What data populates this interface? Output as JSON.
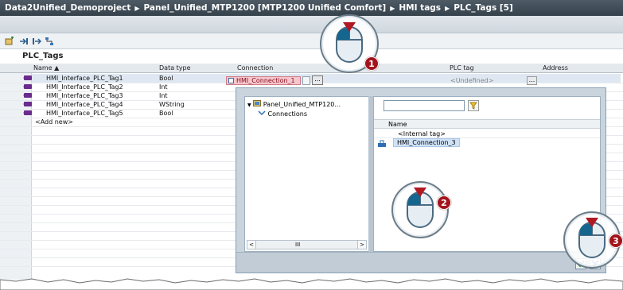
{
  "breadcrumb": {
    "items": [
      "Data2Unified_Demoproject",
      "Panel_Unified_MTP1200 [MTP1200 Unified Comfort]",
      "HMI tags",
      "PLC_Tags [5]"
    ],
    "separator": "▶"
  },
  "table": {
    "title": "PLC_Tags",
    "columns": [
      "Name ▲",
      "Data type",
      "Connection",
      "PLC tag",
      "Address"
    ],
    "rows": [
      {
        "name": "HMI_Interface_PLC_Tag1",
        "type": "Bool",
        "connection": "HMI_Connection_1",
        "plc_tag": "<Undefined>"
      },
      {
        "name": "HMI_Interface_PLC_Tag2",
        "type": "Int"
      },
      {
        "name": "HMI_Interface_PLC_Tag3",
        "type": "Int"
      },
      {
        "name": "HMI_Interface_PLC_Tag4",
        "type": "WString"
      },
      {
        "name": "HMI_Interface_PLC_Tag5",
        "type": "Bool"
      }
    ],
    "add_new": "<Add new>",
    "dots": "..."
  },
  "popup": {
    "tree": {
      "root": "Panel_Unified_MTP120...",
      "child": "Connections"
    },
    "filter_value": "",
    "name_header": "Name",
    "items": [
      "<Internal tag>",
      "HMI_Connection_3"
    ],
    "scroll_mid": "III"
  },
  "callouts": [
    "1",
    "2",
    "3"
  ],
  "colors": {
    "title_bg": "#3e4a55",
    "highlight_pink": "#f6c6cc",
    "badge_red": "#a3131c"
  }
}
